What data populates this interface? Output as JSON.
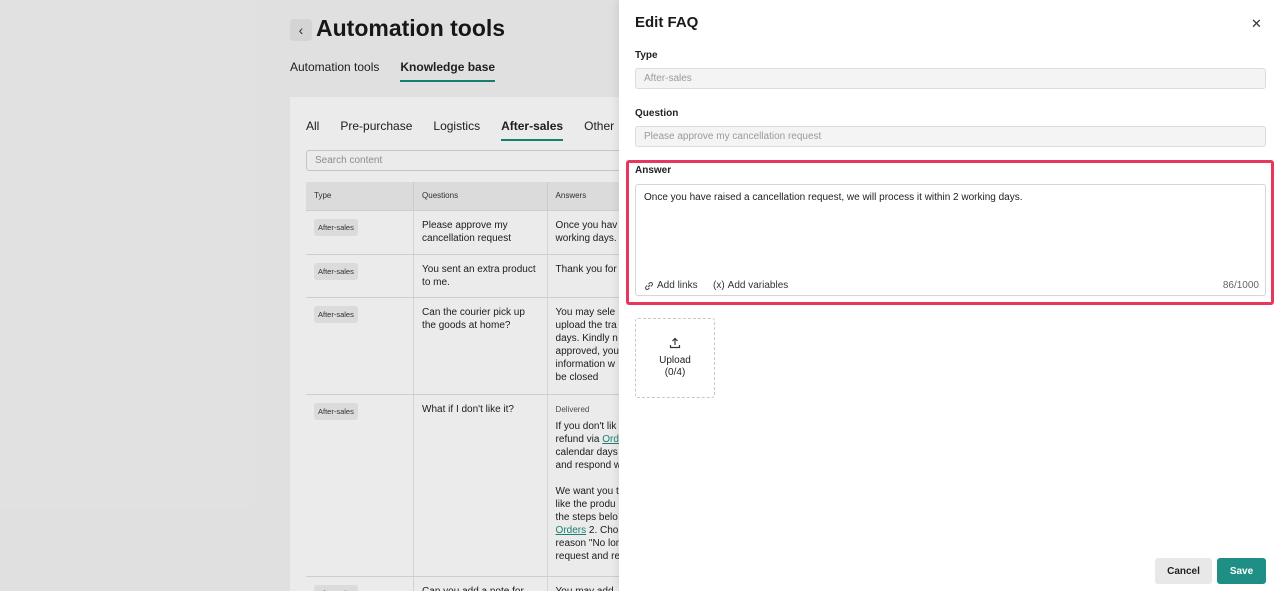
{
  "page": {
    "title": "Automation tools",
    "main_tabs": [
      {
        "label": "Automation tools"
      },
      {
        "label": "Knowledge base"
      }
    ],
    "category_tabs": [
      {
        "label": "All"
      },
      {
        "label": "Pre-purchase"
      },
      {
        "label": "Logistics"
      },
      {
        "label": "After-sales"
      },
      {
        "label": "Other"
      }
    ],
    "search_placeholder": "Search content",
    "table": {
      "headers": [
        "Type",
        "Questions",
        "Answers"
      ],
      "rows": [
        {
          "type": "After-sales",
          "question": "Please approve my cancellation request",
          "answer": "Once you hav\nworking days."
        },
        {
          "type": "After-sales",
          "question": "You sent an extra product to me.",
          "answer": "Thank you for"
        },
        {
          "type": "After-sales",
          "question": "Can the courier pick up the goods at home?",
          "answer": "You may sele\nupload the tra\ndays. Kindly n\napproved, you\ninformation w\nbe closed"
        },
        {
          "type": "After-sales",
          "question": "What if I don't like it?",
          "answer_status": "Delivered",
          "answer_pre": "If you don't lik\nrefund via ",
          "answer_link": "Ord",
          "answer_post": "\ncalendar days\nand respond w",
          "answer2_pre": "We want you t\nlike the produ\nthe steps belo\n",
          "answer2_link": "Orders",
          "answer2_post": " 2. Cho\nreason \"No lon\nrequest and re"
        },
        {
          "type": "After-sales",
          "question": "Can you add a note for me?",
          "answer": "You may add"
        }
      ]
    }
  },
  "drawer": {
    "title": "Edit FAQ",
    "type_label": "Type",
    "type_value": "After-sales",
    "question_label": "Question",
    "question_value": "Please approve my cancellation request",
    "answer_label": "Answer",
    "answer_value": "Once you have raised a cancellation request, we will process it within 2 working days.",
    "add_links_label": "Add links",
    "add_variables_label": "Add variables",
    "add_variables_prefix": "(x)",
    "counter": "86/1000",
    "upload_label": "Upload",
    "upload_count": "(0/4)",
    "cancel_label": "Cancel",
    "save_label": "Save",
    "accent_color": "#1f8f86",
    "highlight_color": "#e8365d"
  }
}
